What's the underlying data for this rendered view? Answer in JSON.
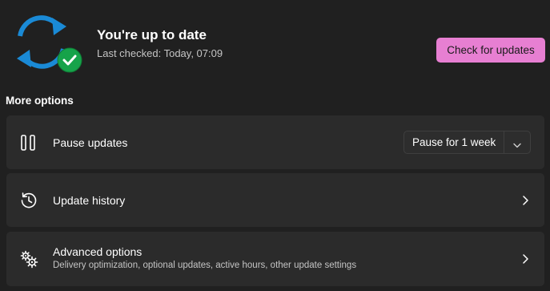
{
  "status": {
    "title": "You're up to date",
    "last_checked": "Last checked: Today, 07:09",
    "check_button_label": "Check for updates",
    "icon": "sync-check-icon"
  },
  "more_options": {
    "heading": "More options",
    "items": [
      {
        "id": "pause",
        "icon": "pause-icon",
        "title": "Pause updates",
        "select_value": "Pause for 1 week"
      },
      {
        "id": "history",
        "icon": "history-icon",
        "title": "Update history"
      },
      {
        "id": "advanced",
        "icon": "gears-icon",
        "title": "Advanced options",
        "description": "Delivery optimization, optional updates, active hours, other update settings"
      }
    ]
  },
  "colors": {
    "background": "#202020",
    "card": "#2b2b2b",
    "accent_button": "#e77fd2",
    "sync_blue": "#1a8ad6",
    "check_green": "#16a34a"
  }
}
